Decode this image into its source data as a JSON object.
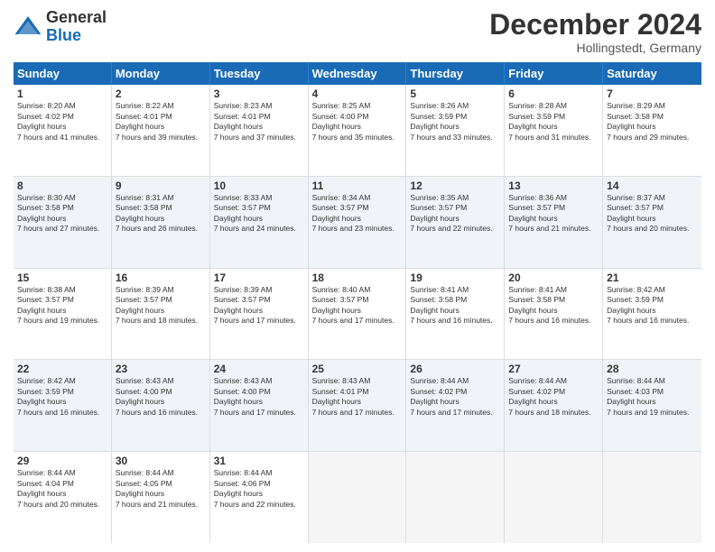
{
  "logo": {
    "general": "General",
    "blue": "Blue"
  },
  "title": "December 2024",
  "location": "Hollingstedt, Germany",
  "days": [
    "Sunday",
    "Monday",
    "Tuesday",
    "Wednesday",
    "Thursday",
    "Friday",
    "Saturday"
  ],
  "rows": [
    [
      {
        "day": "1",
        "sunrise": "8:20 AM",
        "sunset": "4:02 PM",
        "daylight": "7 hours and 41 minutes."
      },
      {
        "day": "2",
        "sunrise": "8:22 AM",
        "sunset": "4:01 PM",
        "daylight": "7 hours and 39 minutes."
      },
      {
        "day": "3",
        "sunrise": "8:23 AM",
        "sunset": "4:01 PM",
        "daylight": "7 hours and 37 minutes."
      },
      {
        "day": "4",
        "sunrise": "8:25 AM",
        "sunset": "4:00 PM",
        "daylight": "7 hours and 35 minutes."
      },
      {
        "day": "5",
        "sunrise": "8:26 AM",
        "sunset": "3:59 PM",
        "daylight": "7 hours and 33 minutes."
      },
      {
        "day": "6",
        "sunrise": "8:28 AM",
        "sunset": "3:59 PM",
        "daylight": "7 hours and 31 minutes."
      },
      {
        "day": "7",
        "sunrise": "8:29 AM",
        "sunset": "3:58 PM",
        "daylight": "7 hours and 29 minutes."
      }
    ],
    [
      {
        "day": "8",
        "sunrise": "8:30 AM",
        "sunset": "3:58 PM",
        "daylight": "7 hours and 27 minutes."
      },
      {
        "day": "9",
        "sunrise": "8:31 AM",
        "sunset": "3:58 PM",
        "daylight": "7 hours and 26 minutes."
      },
      {
        "day": "10",
        "sunrise": "8:33 AM",
        "sunset": "3:57 PM",
        "daylight": "7 hours and 24 minutes."
      },
      {
        "day": "11",
        "sunrise": "8:34 AM",
        "sunset": "3:57 PM",
        "daylight": "7 hours and 23 minutes."
      },
      {
        "day": "12",
        "sunrise": "8:35 AM",
        "sunset": "3:57 PM",
        "daylight": "7 hours and 22 minutes."
      },
      {
        "day": "13",
        "sunrise": "8:36 AM",
        "sunset": "3:57 PM",
        "daylight": "7 hours and 21 minutes."
      },
      {
        "day": "14",
        "sunrise": "8:37 AM",
        "sunset": "3:57 PM",
        "daylight": "7 hours and 20 minutes."
      }
    ],
    [
      {
        "day": "15",
        "sunrise": "8:38 AM",
        "sunset": "3:57 PM",
        "daylight": "7 hours and 19 minutes."
      },
      {
        "day": "16",
        "sunrise": "8:39 AM",
        "sunset": "3:57 PM",
        "daylight": "7 hours and 18 minutes."
      },
      {
        "day": "17",
        "sunrise": "8:39 AM",
        "sunset": "3:57 PM",
        "daylight": "7 hours and 17 minutes."
      },
      {
        "day": "18",
        "sunrise": "8:40 AM",
        "sunset": "3:57 PM",
        "daylight": "7 hours and 17 minutes."
      },
      {
        "day": "19",
        "sunrise": "8:41 AM",
        "sunset": "3:58 PM",
        "daylight": "7 hours and 16 minutes."
      },
      {
        "day": "20",
        "sunrise": "8:41 AM",
        "sunset": "3:58 PM",
        "daylight": "7 hours and 16 minutes."
      },
      {
        "day": "21",
        "sunrise": "8:42 AM",
        "sunset": "3:59 PM",
        "daylight": "7 hours and 16 minutes."
      }
    ],
    [
      {
        "day": "22",
        "sunrise": "8:42 AM",
        "sunset": "3:59 PM",
        "daylight": "7 hours and 16 minutes."
      },
      {
        "day": "23",
        "sunrise": "8:43 AM",
        "sunset": "4:00 PM",
        "daylight": "7 hours and 16 minutes."
      },
      {
        "day": "24",
        "sunrise": "8:43 AM",
        "sunset": "4:00 PM",
        "daylight": "7 hours and 17 minutes."
      },
      {
        "day": "25",
        "sunrise": "8:43 AM",
        "sunset": "4:01 PM",
        "daylight": "7 hours and 17 minutes."
      },
      {
        "day": "26",
        "sunrise": "8:44 AM",
        "sunset": "4:02 PM",
        "daylight": "7 hours and 17 minutes."
      },
      {
        "day": "27",
        "sunrise": "8:44 AM",
        "sunset": "4:02 PM",
        "daylight": "7 hours and 18 minutes."
      },
      {
        "day": "28",
        "sunrise": "8:44 AM",
        "sunset": "4:03 PM",
        "daylight": "7 hours and 19 minutes."
      }
    ],
    [
      {
        "day": "29",
        "sunrise": "8:44 AM",
        "sunset": "4:04 PM",
        "daylight": "7 hours and 20 minutes."
      },
      {
        "day": "30",
        "sunrise": "8:44 AM",
        "sunset": "4:05 PM",
        "daylight": "7 hours and 21 minutes."
      },
      {
        "day": "31",
        "sunrise": "8:44 AM",
        "sunset": "4:06 PM",
        "daylight": "7 hours and 22 minutes."
      },
      null,
      null,
      null,
      null
    ]
  ]
}
